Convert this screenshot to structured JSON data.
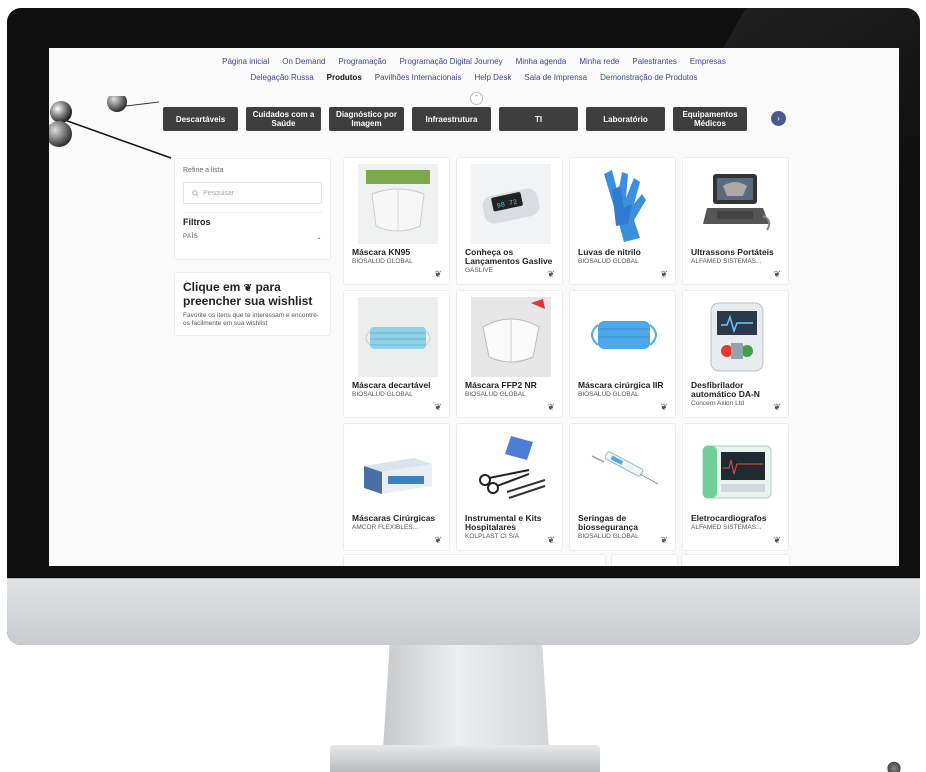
{
  "nav": {
    "row1": [
      "Página inicial",
      "On Demand",
      "Programação",
      "Programação Digital Journey",
      "Minha agenda",
      "Minha rede",
      "Palestrantes",
      "Empresas"
    ],
    "row2": [
      "Delegação Russa",
      "Produtos",
      "Pavilhões Internacionais",
      "Help Desk",
      "Sala de Imprensa",
      "Demonstração de Produtos"
    ],
    "active": "Produtos"
  },
  "categories": [
    "Descartáveis",
    "Cuidados com a Saúde",
    "Diagnóstico por Imagem",
    "Infraestrutura",
    "TI",
    "Laboratório",
    "Equipamentos Médicos"
  ],
  "sidebar": {
    "refine_label": "Refine a lista",
    "search_placeholder": "Pesquisar",
    "filters_title": "Filtros",
    "country_label": "PAÍS",
    "wishlist_title": "Clique em  para preencher sua wishlist",
    "wishlist_title_a": "Clique em",
    "wishlist_title_b": "para preencher sua wishlist",
    "wishlist_desc": "Favorite os itens que te interessam e encontre-os facilmente em sua wishlist"
  },
  "products": [
    {
      "name": "Máscara KN95",
      "company": "BIOSALUD GLOBAL",
      "icon": "kn95-mask"
    },
    {
      "name": "Conheça os Lançamentos Gaslive",
      "company": "GASLIVE",
      "icon": "pulse-oximeter"
    },
    {
      "name": "Luvas de nitrilo",
      "company": "BIOSALUD GLOBAL",
      "icon": "nitrile-gloves"
    },
    {
      "name": "Ultrassons Portáteis",
      "company": "ALFAMED SISTEMAS...",
      "icon": "portable-ultrasound"
    },
    {
      "name": "Máscara decartável",
      "company": "BIOSALUD GLOBAL",
      "icon": "disposable-mask"
    },
    {
      "name": "Máscara FFP2 NR",
      "company": "BIOSALUD GLOBAL",
      "icon": "ffp2-mask"
    },
    {
      "name": "Máscara cirúrgica IIR",
      "company": "BIOSALUD GLOBAL",
      "icon": "surgical-mask"
    },
    {
      "name": "Desfibrilador automático DA-N",
      "company": "Concern Axion Ltd",
      "icon": "defibrillator"
    },
    {
      "name": "Máscaras Cirúrgicas",
      "company": "AMCOR FLEXIBLES...",
      "icon": "mask-box"
    },
    {
      "name": "Instrumental e Kits Hospitalares",
      "company": "KOLPLAST CI S/A",
      "icon": "surgical-instruments"
    },
    {
      "name": "Seringas de biossegurança",
      "company": "BIOSALUD GLOBAL",
      "icon": "syringe"
    },
    {
      "name": "Eletrocardiografos",
      "company": "ALFAMED SISTEMAS...",
      "icon": "ecg-device"
    }
  ]
}
